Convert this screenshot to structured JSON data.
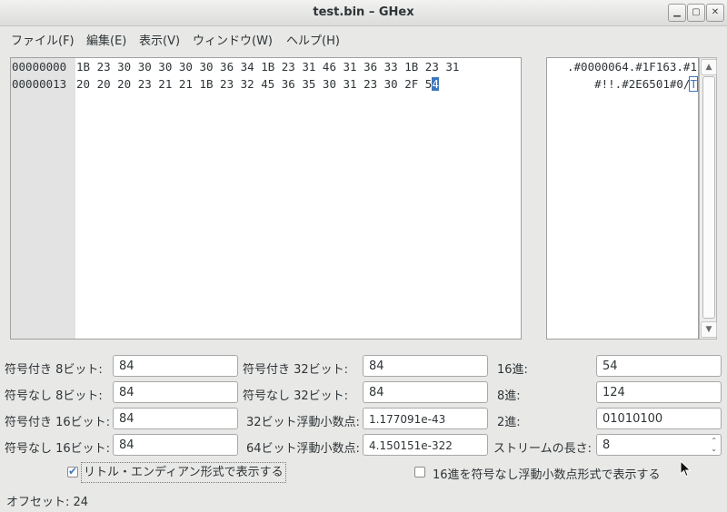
{
  "window": {
    "title": "test.bin – GHex",
    "minimize_icon": "minimize-icon",
    "maximize_icon": "maximize-icon",
    "close_icon": "close-icon"
  },
  "menu": {
    "file": "ファイル(F)",
    "edit": "編集(E)",
    "view": "表示(V)",
    "window": "ウィンドウ(W)",
    "help": "ヘルプ(H)"
  },
  "editor": {
    "offsets": [
      "00000000",
      "00000013"
    ],
    "hex_lines": [
      "1B 23 30 30 30 30 30 36 34 1B 23 31 46 31 36 33 1B 23 31",
      "20 20 20 23 21 21 1B 23 32 45 36 35 30 31 23 30 2F 5"
    ],
    "cursor_hex_char": "4",
    "ascii_lines": [
      ".#0000064.#1F163.#1",
      "  #!!.#2E6501#0/"
    ],
    "cursor_ascii_char": "T"
  },
  "converter": {
    "signed8_label": "符号付き 8ビット:",
    "signed8_value": "84",
    "unsigned8_label": "符号なし 8ビット:",
    "unsigned8_value": "84",
    "signed16_label": "符号付き 16ビット:",
    "signed16_value": "84",
    "unsigned16_label": "符号なし 16ビット:",
    "unsigned16_value": "84",
    "signed32_label": "符号付き 32ビット:",
    "signed32_value": "84",
    "unsigned32_label": "符号なし 32ビット:",
    "unsigned32_value": "84",
    "float32_label": "32ビット浮動小数点:",
    "float32_value": "1.177091e-43",
    "float64_label": "64ビット浮動小数点:",
    "float64_value": "4.150151e-322",
    "hex_label": "16進:",
    "hex_value": "54",
    "oct_label": "8進:",
    "oct_value": "124",
    "bin_label": "2進:",
    "bin_value": "01010100",
    "stream_label": "ストリームの長さ:",
    "stream_value": "8",
    "little_endian_label": "リトル・エンディアン形式で表示する",
    "little_endian_checked": true,
    "unsigned_hex_float_label": "16進を符号なし浮動小数点形式で表示する",
    "unsigned_hex_float_checked": false
  },
  "status": {
    "offset": "オフセット: 24"
  },
  "colors": {
    "selection": "#3e77bd",
    "window_bg": "#e8e8e7"
  }
}
